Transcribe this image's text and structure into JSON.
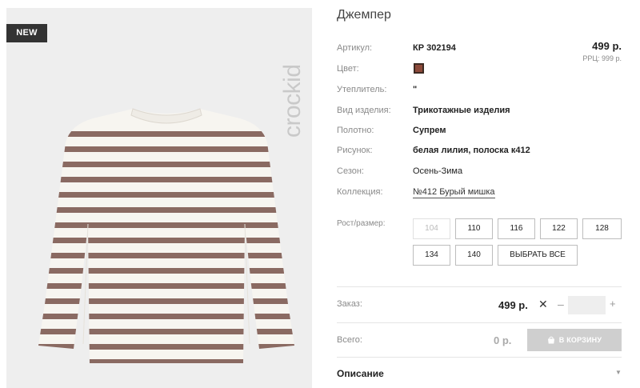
{
  "product": {
    "badge": "NEW",
    "brand_logo": "crockid",
    "title": "Джемпер",
    "price": "499 р.",
    "rrc": "РРЦ: 999 р.",
    "color_swatch": "#8c4a3a"
  },
  "specs": [
    {
      "label": "Артикул:",
      "value": "КР 302194"
    },
    {
      "label": "Цвет:",
      "value": ""
    },
    {
      "label": "Утеплитель:",
      "value": "\""
    },
    {
      "label": "Вид изделия:",
      "value": "Трикотажные изделия"
    },
    {
      "label": "Полотно:",
      "value": "Супрем"
    },
    {
      "label": "Рисунок:",
      "value": "белая лилия, полоска к412"
    },
    {
      "label": "Сезон:",
      "value": "Осень-Зима"
    },
    {
      "label": "Коллекция:",
      "value": "№412 Бурый мишка"
    }
  ],
  "sizes": {
    "label": "Рост/размер:",
    "options": [
      "104",
      "110",
      "116",
      "122",
      "128",
      "134",
      "140"
    ],
    "select_all": "ВЫБРАТЬ ВСЕ"
  },
  "order": {
    "label": "Заказ:",
    "price": "499 р.",
    "times": "✕",
    "minus": "–",
    "plus": "+",
    "quantity": ""
  },
  "total": {
    "label": "Всего:",
    "value": "0 р.",
    "cart_button": "В КОРЗИНУ"
  },
  "description": {
    "label": "Описание",
    "chevron": "▼"
  },
  "colors": {
    "stripe": "#8a6a62",
    "shirt": "#f7f5f0",
    "photo_bg": "#eeeeee"
  }
}
